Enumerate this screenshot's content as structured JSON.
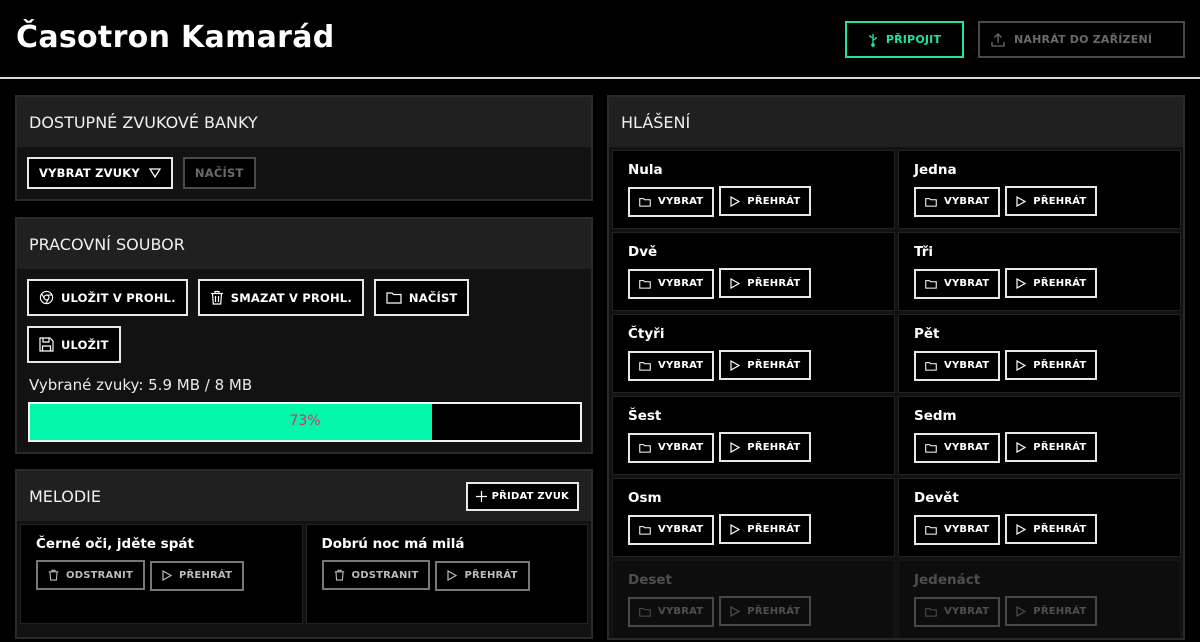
{
  "app": {
    "title": "Časotron Kamarád"
  },
  "header": {
    "connect_label": "PŘIPOJIT",
    "upload_label": "NAHRÁT DO ZAŘÍZENÍ"
  },
  "banks": {
    "title": "DOSTUPNÉ ZVUKOVÉ BANKY",
    "select_label": "VYBRAT ZVUKY",
    "load_label": "NAČÍST"
  },
  "file": {
    "title": "PRACOVNÍ SOUBOR",
    "save_browser_label": "ULOŽIT V PROHL.",
    "delete_browser_label": "SMAZAT V PROHL.",
    "load_label": "NAČÍST",
    "save_label": "ULOŽIT",
    "sizes_text": "Vybrané zvuky: 5.9 MB / 8 MB",
    "progress_percent": 73,
    "progress_text": "73%",
    "accent_color": "#02f7a8"
  },
  "melodies": {
    "title": "MELODIE",
    "add_label": "PŘIDAT ZVUK",
    "items": [
      {
        "name": "Černé oči, jděte spát",
        "remove_label": "ODSTRANIT",
        "play_label": "PŘEHRÁT"
      },
      {
        "name": "Dobrú noc má milá",
        "remove_label": "ODSTRANIT",
        "play_label": "PŘEHRÁT"
      }
    ]
  },
  "announcements": {
    "title": "HLÁŠENÍ",
    "select_label": "VYBRAT",
    "play_label": "PŘEHRÁT",
    "items": [
      "Nula",
      "Jedna",
      "Dvě",
      "Tři",
      "Čtyři",
      "Pět",
      "Šest",
      "Sedm",
      "Osm",
      "Devět",
      "Deset",
      "Jedenáct"
    ]
  }
}
